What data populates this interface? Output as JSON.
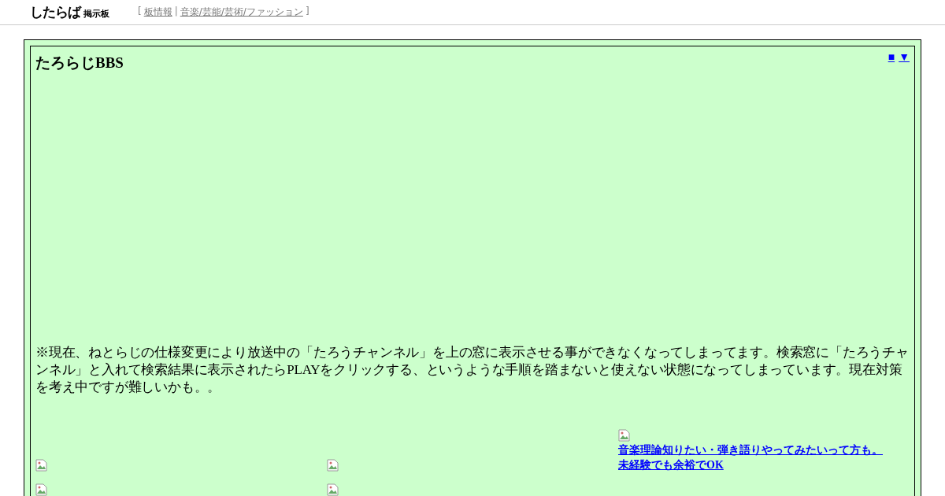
{
  "header": {
    "logo": {
      "main": "したらば",
      "sub": "掲示板"
    },
    "open_bracket": "[",
    "links": [
      "板情報",
      "音楽/芸能/芸術/ファッション"
    ],
    "separator": "|",
    "close_bracket": "]"
  },
  "board": {
    "title": "たろらじBBS",
    "nav_links": [
      "■",
      "▼"
    ],
    "notice": "※現在、ねとらじの仕様変更により放送中の「たろうチャンネル」を上の窓に表示させる事ができなくなってしまってます。検索窓に「たろうチャンネル」と入れて検索結果に表示されたらPLAYをクリックする、というような手順を踏まないと使えない状態になってしまっています。現在対策を考え中ですが難しいかも。。",
    "banners": [
      {
        "kind": "image"
      },
      {
        "kind": "image"
      },
      {
        "kind": "image_link",
        "links": [
          "音楽理論知りたい・弾き語りやってみたいって方も。",
          "未経験でも余裕でOK"
        ]
      },
      {
        "kind": "image"
      },
      {
        "kind": "image"
      }
    ]
  }
}
